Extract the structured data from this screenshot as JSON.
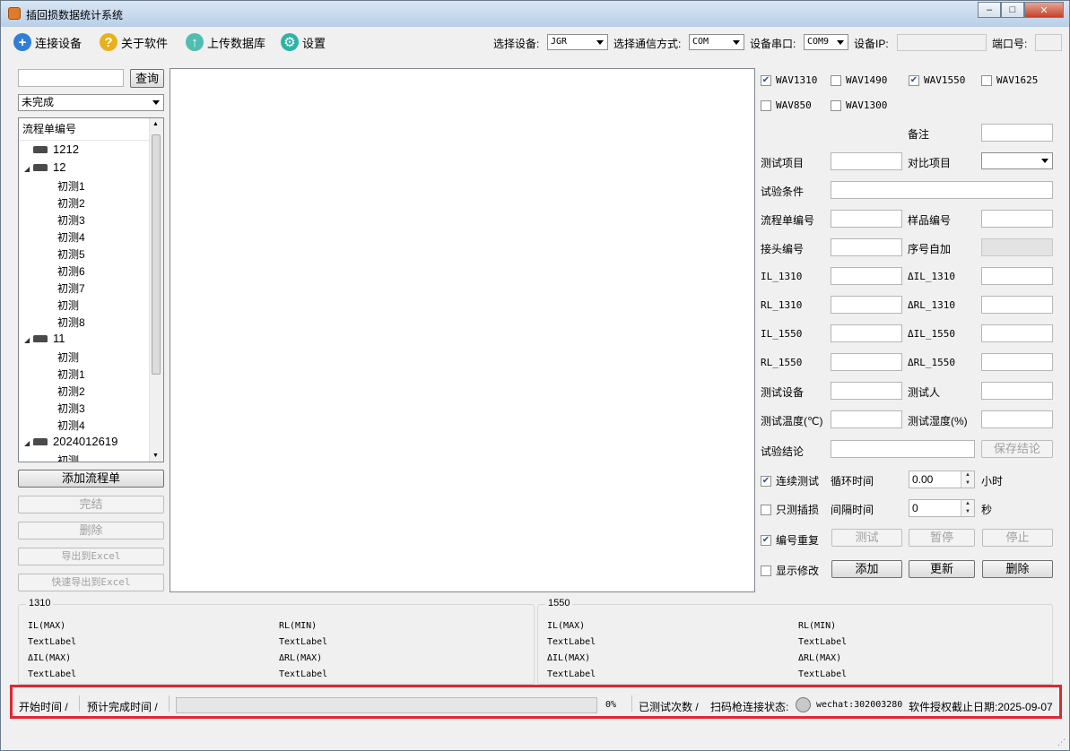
{
  "window": {
    "title": "插回损数据统计系统",
    "minimize": "–",
    "maximize": "□",
    "close": "✕"
  },
  "toolbar": {
    "connect": "连接设备",
    "about": "关于软件",
    "upload": "上传数据库",
    "settings": "设置",
    "select_device_label": "选择设备:",
    "device_value": "JGR",
    "comm_mode_label": "选择通信方式:",
    "comm_mode_value": "COM",
    "serial_label": "设备串口:",
    "serial_value": "COM9",
    "ip_label": "设备IP:",
    "ip_value": "",
    "port_label": "端口号:",
    "port_value": ""
  },
  "left": {
    "search_value": "",
    "query_button": "查询",
    "filter_value": "未完成",
    "tree_header": "流程单编号",
    "tree": [
      {
        "type": "group",
        "label": "1212",
        "expanded": false
      },
      {
        "type": "group",
        "label": "12",
        "expanded": true
      },
      {
        "type": "leaf",
        "label": "初测1"
      },
      {
        "type": "leaf",
        "label": "初测2"
      },
      {
        "type": "leaf",
        "label": "初测3"
      },
      {
        "type": "leaf",
        "label": "初测4"
      },
      {
        "type": "leaf",
        "label": "初测5"
      },
      {
        "type": "leaf",
        "label": "初测6"
      },
      {
        "type": "leaf",
        "label": "初测7"
      },
      {
        "type": "leaf",
        "label": "初测"
      },
      {
        "type": "leaf",
        "label": "初测8"
      },
      {
        "type": "group",
        "label": "11",
        "expanded": true
      },
      {
        "type": "leaf",
        "label": "初测"
      },
      {
        "type": "leaf",
        "label": "初测1"
      },
      {
        "type": "leaf",
        "label": "初测2"
      },
      {
        "type": "leaf",
        "label": "初测3"
      },
      {
        "type": "leaf",
        "label": "初测4"
      },
      {
        "type": "group",
        "label": "2024012619",
        "expanded": true
      },
      {
        "type": "leaf",
        "label": "初测"
      }
    ],
    "add_flow": "添加流程单",
    "finish": "完结",
    "delete": "删除",
    "export_excel": "导出到Excel",
    "quick_export_excel": "快速导出到Excel"
  },
  "right": {
    "wavelengths": [
      {
        "label": "WAV1310",
        "checked": true
      },
      {
        "label": "WAV1490",
        "checked": false
      },
      {
        "label": "WAV1550",
        "checked": true
      },
      {
        "label": "WAV1625",
        "checked": false
      },
      {
        "label": "WAV850",
        "checked": false
      },
      {
        "label": "WAV1300",
        "checked": false
      }
    ],
    "remark": "备注",
    "test_item": "测试项目",
    "compare_item": "对比项目",
    "test_condition": "试验条件",
    "flow_no": "流程单编号",
    "sample_no": "样品编号",
    "connector_no": "接头编号",
    "serial_auto": "序号自加",
    "il_1310": "IL_1310",
    "d_il_1310": "ΔIL_1310",
    "rl_1310": "RL_1310",
    "d_rl_1310": "ΔRL_1310",
    "il_1550": "IL_1550",
    "d_il_1550": "ΔIL_1550",
    "rl_1550": "RL_1550",
    "d_rl_1550": "ΔRL_1550",
    "test_device": "测试设备",
    "tester": "测试人",
    "test_temp": "测试温度(℃)",
    "test_humidity": "测试湿度(%)",
    "test_conclusion": "试验结论",
    "save_conclusion": "保存结论",
    "continuous_test": "连续测试",
    "continuous_checked": true,
    "cycle_time": "循环时间",
    "cycle_value": "0.00",
    "hours": "小时",
    "only_il": "只测插损",
    "only_il_checked": false,
    "interval_time": "间隔时间",
    "interval_value": "0",
    "seconds": "秒",
    "number_repeat": "编号重复",
    "number_repeat_checked": true,
    "test": "测试",
    "pause": "暂停",
    "stop": "停止",
    "show_modify": "显示修改",
    "show_modify_checked": false,
    "add": "添加",
    "update": "更新",
    "delete": "删除"
  },
  "groups": [
    {
      "title": "1310",
      "il_max": "IL(MAX)",
      "rl_min": "RL(MIN)",
      "il_val": "TextLabel",
      "rl_val": "TextLabel",
      "dil_max": "ΔIL(MAX)",
      "drl_max": "ΔRL(MAX)",
      "dil_val": "TextLabel",
      "drl_val": "TextLabel"
    },
    {
      "title": "1550",
      "il_max": "IL(MAX)",
      "rl_min": "RL(MIN)",
      "il_val": "TextLabel",
      "rl_val": "TextLabel",
      "dil_max": "ΔIL(MAX)",
      "drl_max": "ΔRL(MAX)",
      "dil_val": "TextLabel",
      "drl_val": "TextLabel"
    }
  ],
  "status": {
    "start_time": "开始时间 /",
    "est_finish": "预计完成时间 /",
    "progress_percent": 0,
    "progress_text": "0%",
    "tested_count": "已测试次数 /",
    "scanner_status": "扫码枪连接状态:",
    "wechat": "wechat:302003280",
    "license": "软件授权截止日期:2025-09-07"
  }
}
